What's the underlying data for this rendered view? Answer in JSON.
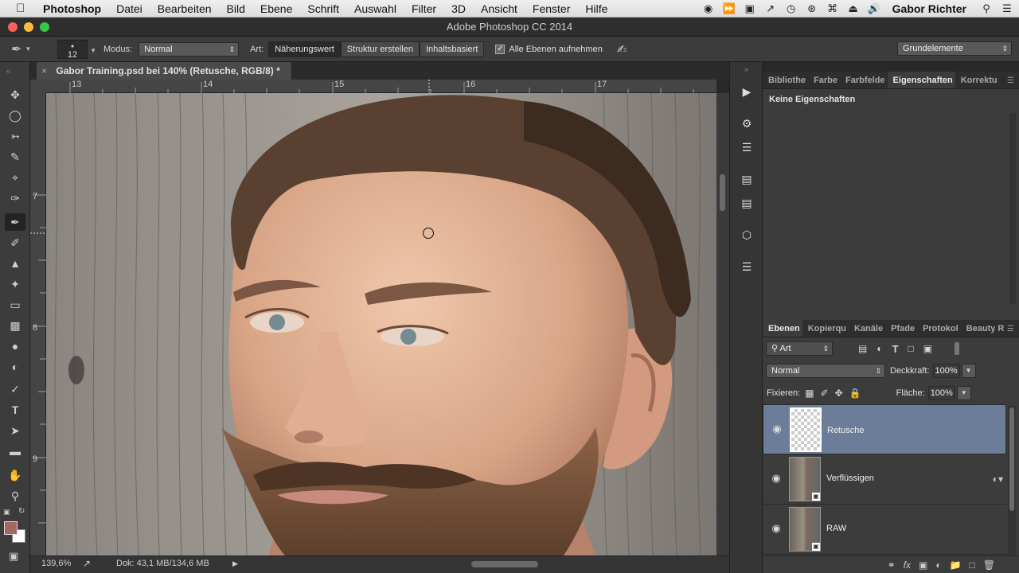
{
  "menubar": {
    "app": "Photoshop",
    "items": [
      "Datei",
      "Bearbeiten",
      "Bild",
      "Ebene",
      "Schrift",
      "Auswahl",
      "Filter",
      "3D",
      "Ansicht",
      "Fenster",
      "Hilfe"
    ],
    "user": "Gabor Richter"
  },
  "window": {
    "title": "Adobe Photoshop CC 2014"
  },
  "options": {
    "brush_size": "12",
    "modus_label": "Modus:",
    "modus_value": "Normal",
    "art_label": "Art:",
    "art_options": [
      "Näherungswert",
      "Struktur erstellen",
      "Inhaltsbasiert"
    ],
    "art_selected": "Näherungswert",
    "sample_all_label": "Alle Ebenen aufnehmen",
    "sample_all_checked": true,
    "workspace": "Grundelemente"
  },
  "document": {
    "tab_title": "Gabor Training.psd bei 140% (Retusche, RGB/8) *",
    "ruler_top": [
      "13",
      "14",
      "15",
      "16",
      "17"
    ],
    "ruler_left": [
      "7",
      "8",
      "9"
    ],
    "zoom": "139,6%",
    "doc_size": "Dok: 43,1 MB/134,6 MB"
  },
  "properties_panel": {
    "tabs": [
      "Bibliothe",
      "Farbe",
      "Farbfelde",
      "Eigenschaften",
      "Korrektu"
    ],
    "active_tab": "Eigenschaften",
    "content": "Keine Eigenschaften"
  },
  "layers_panel": {
    "tabs": [
      "Ebenen",
      "Kopierqu",
      "Kanäle",
      "Pfade",
      "Protokol",
      "Beauty R"
    ],
    "active_tab": "Ebenen",
    "filter_kind": "Art",
    "blend_mode": "Normal",
    "opacity_label": "Deckkraft:",
    "opacity_value": "100%",
    "lock_label": "Fixieren:",
    "fill_label": "Fläche:",
    "fill_value": "100%",
    "layers": [
      {
        "name": "Retusche",
        "selected": true,
        "type": "empty"
      },
      {
        "name": "Verflüssigen",
        "selected": false,
        "type": "smart"
      },
      {
        "name": "RAW",
        "selected": false,
        "type": "smart"
      }
    ]
  },
  "colors": {
    "foreground": "#a2685f",
    "background": "#ffffff",
    "selected_layer": "#6c7d99"
  }
}
